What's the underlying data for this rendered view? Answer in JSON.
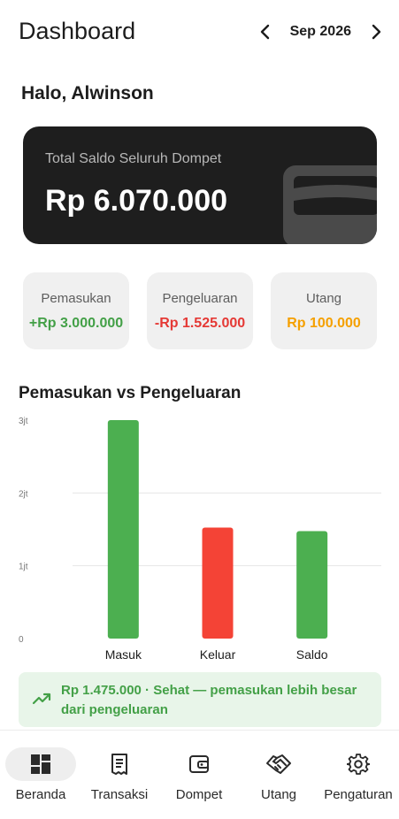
{
  "header": {
    "title": "Dashboard",
    "month": "Sep 2026"
  },
  "greeting": "Halo, Alwinson",
  "balance_card": {
    "label": "Total Saldo Seluruh Dompet",
    "value": "Rp 6.070.000",
    "icon": "wallet-icon"
  },
  "stats": [
    {
      "label": "Pemasukan",
      "value": "+Rp 3.000.000",
      "color": "#43a047"
    },
    {
      "label": "Pengeluaran",
      "value": "-Rp 1.525.000",
      "color": "#e53935"
    },
    {
      "label": "Utang",
      "value": "Rp 100.000",
      "color": "#f5a000"
    }
  ],
  "chart_title": "Pemasukan vs Pengeluaran",
  "chart_data": {
    "type": "bar",
    "categories": [
      "Masuk",
      "Keluar",
      "Saldo"
    ],
    "values": [
      3000000,
      1525000,
      1475000
    ],
    "colors": [
      "#4caf50",
      "#f44336",
      "#4caf50"
    ],
    "yticks": [
      {
        "value": 0,
        "label": "0"
      },
      {
        "value": 1000000,
        "label": "1jt"
      },
      {
        "value": 2000000,
        "label": "2jt"
      },
      {
        "value": 3000000,
        "label": "3jt"
      }
    ],
    "ylim": [
      0,
      3000000
    ],
    "grid": true
  },
  "summary": {
    "text": "Rp 1.475.000 · Sehat — pemasukan lebih besar dari pengeluaran",
    "icon": "trending-up-icon"
  },
  "nav": [
    {
      "label": "Beranda",
      "icon": "dashboard-icon",
      "active": true
    },
    {
      "label": "Transaksi",
      "icon": "receipt-icon",
      "active": false
    },
    {
      "label": "Dompet",
      "icon": "wallet-icon",
      "active": false
    },
    {
      "label": "Utang",
      "icon": "handshake-icon",
      "active": false
    },
    {
      "label": "Pengaturan",
      "icon": "gear-icon",
      "active": false
    }
  ]
}
